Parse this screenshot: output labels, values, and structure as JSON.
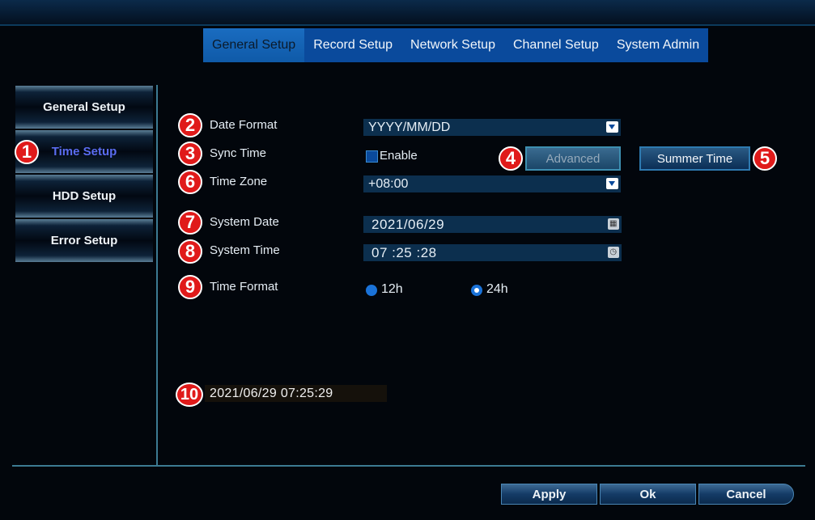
{
  "tabs": [
    {
      "label": "General Setup",
      "active": true
    },
    {
      "label": "Record Setup"
    },
    {
      "label": "Network Setup"
    },
    {
      "label": "Channel Setup"
    },
    {
      "label": "System Admin"
    }
  ],
  "sidebar": {
    "items": [
      {
        "label": "General Setup"
      },
      {
        "label": "Time Setup",
        "active": true
      },
      {
        "label": "HDD Setup"
      },
      {
        "label": "Error Setup"
      }
    ]
  },
  "badges": [
    "1",
    "2",
    "3",
    "4",
    "5",
    "6",
    "7",
    "8",
    "9",
    "10"
  ],
  "form": {
    "date_format": {
      "label": "Date Format",
      "value": "YYYY/MM/DD"
    },
    "sync_time": {
      "label": "Sync Time",
      "checkbox_label": "Enable",
      "checked": false
    },
    "advanced_button": "Advanced",
    "summer_time_button": "Summer Time",
    "time_zone": {
      "label": "Time Zone",
      "value": "+08:00"
    },
    "system_date": {
      "label": "System Date",
      "value": "2021/06/29"
    },
    "system_time": {
      "label": "System Time",
      "value": "07 :25 :28"
    },
    "time_format": {
      "label": "Time Format",
      "options": [
        "12h",
        "24h"
      ],
      "selected": "24h"
    }
  },
  "current_datetime": "2021/06/29 07:25:29",
  "actions": {
    "apply": "Apply",
    "ok": "Ok",
    "cancel": "Cancel"
  },
  "colors": {
    "accent": "#0a4a9c",
    "badge": "#e01a1a",
    "active_sidebar_text": "#5a6cf0"
  },
  "icons": {
    "date_picker": "calendar-icon",
    "time_picker": "clock-icon",
    "select": "chevron-down-icon"
  }
}
